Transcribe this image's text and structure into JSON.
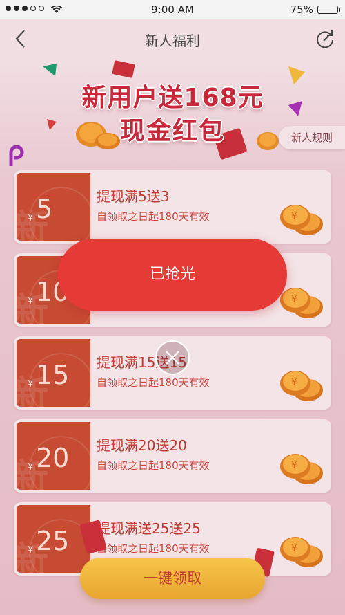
{
  "status_bar": {
    "time": "9:00 AM",
    "battery": "75%",
    "battery_level": 0.75
  },
  "nav": {
    "title": "新人福利",
    "back_icon": "chevron-left-icon",
    "refresh_icon": "refresh-icon"
  },
  "banner": {
    "line1": "新用户送168元",
    "line2": "现金红包",
    "rules_label": "新人规则"
  },
  "coupons": [
    {
      "currency": "¥",
      "amount": "5",
      "title": "提现满5送3",
      "subtitle": "自领取之日起180天有效"
    },
    {
      "currency": "¥",
      "amount": "10",
      "title": "",
      "subtitle": ""
    },
    {
      "currency": "¥",
      "amount": "15",
      "title": "提现满15送15",
      "subtitle": "自领取之日起180天有效"
    },
    {
      "currency": "¥",
      "amount": "20",
      "title": "提现满20送20",
      "subtitle": "自领取之日起180天有效"
    },
    {
      "currency": "¥",
      "amount": "25",
      "title": "提现满送25送25",
      "subtitle": "自领取之日起180天有效"
    }
  ],
  "stub_watermark": "新",
  "popup": {
    "sold_out_label": "已抢光",
    "close_icon": "close-icon"
  },
  "footer": {
    "claim_all_label": "一键领取"
  },
  "colors": {
    "accent_red": "#e63a37",
    "stub_red": "#c74a32",
    "gold": "#f7c64a"
  }
}
